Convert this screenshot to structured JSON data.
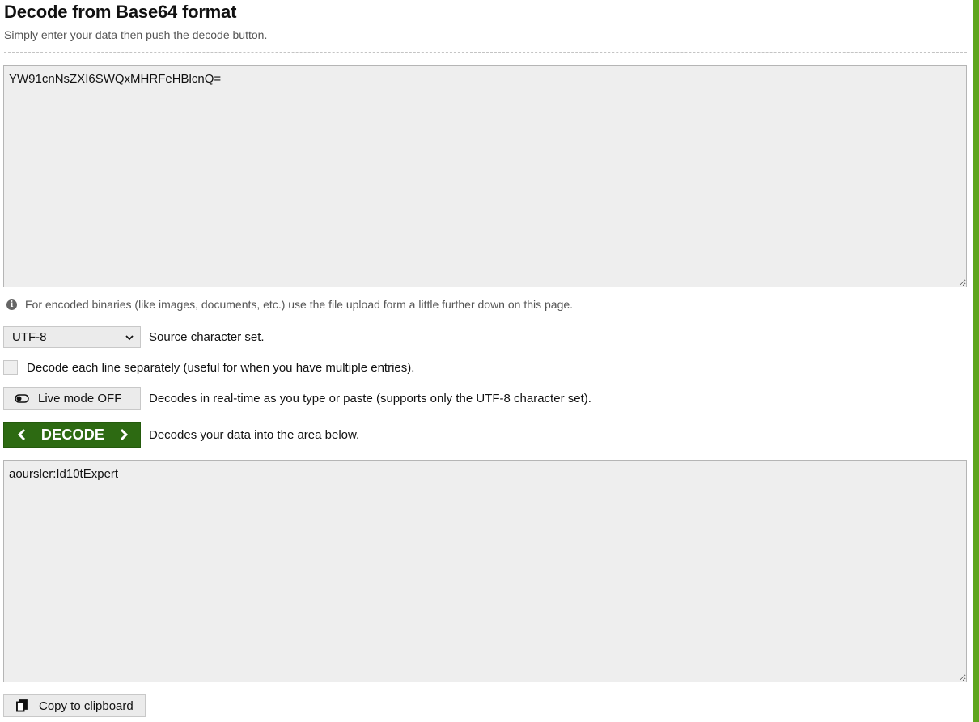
{
  "header": {
    "title": "Decode from Base64 format",
    "subtitle": "Simply enter your data then push the decode button."
  },
  "input": {
    "value": "YW91cnNsZXI6SWQxMHRFeHBlcnQ="
  },
  "note": {
    "icon": "info-icon",
    "text": "For encoded binaries (like images, documents, etc.) use the file upload form a little further down on this page."
  },
  "charset": {
    "selected": "UTF-8",
    "label": "Source character set."
  },
  "line_option": {
    "checked": false,
    "label": "Decode each line separately (useful for when you have multiple entries)."
  },
  "live_mode": {
    "button_label": "Live mode OFF",
    "icon": "toggle-off-icon",
    "description": "Decodes in real-time as you type or paste (supports only the UTF-8 character set)."
  },
  "decode": {
    "button_label": "DECODE",
    "description": "Decodes your data into the area below.",
    "color": "#2d6a12"
  },
  "output": {
    "value": "aoursler:Id10tExpert"
  },
  "copy": {
    "button_label": "Copy to clipboard",
    "icon": "copy-icon"
  },
  "theme": {
    "accent": "#5fa51e",
    "area_background": "#eeeeee"
  }
}
